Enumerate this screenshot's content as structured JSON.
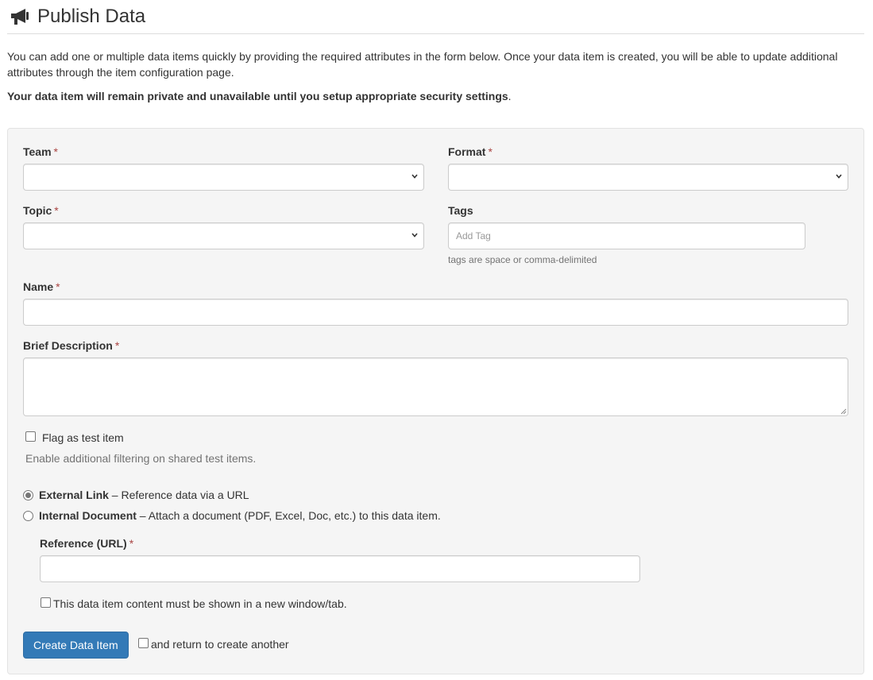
{
  "page": {
    "title": "Publish Data",
    "title_icon": "megaphone-icon",
    "intro": "You can add one or multiple data items quickly by providing the required attributes in the form below. Once your data item is created, you will be able to update additional attributes through the item configuration page.",
    "warning_bold": "Your data item will remain private and unavailable until you setup appropriate security settings",
    "warning_end": "."
  },
  "form": {
    "required_marker": "*",
    "team": {
      "label": "Team",
      "value": ""
    },
    "format": {
      "label": "Format",
      "value": ""
    },
    "topic": {
      "label": "Topic",
      "value": ""
    },
    "tags": {
      "label": "Tags",
      "placeholder": "Add Tag",
      "help": "tags are space or comma-delimited"
    },
    "name": {
      "label": "Name",
      "value": ""
    },
    "description": {
      "label": "Brief Description",
      "value": ""
    },
    "test_flag": {
      "label": "Flag as test item",
      "help": "Enable additional filtering on shared test items.",
      "checked": false
    },
    "link_type": {
      "selected": "external",
      "external": {
        "title": "External Link",
        "desc": " – Reference data via a URL"
      },
      "internal": {
        "title": "Internal Document",
        "desc": " – Attach a document (PDF, Excel, Doc, etc.) to this data item."
      }
    },
    "reference_url": {
      "label": "Reference (URL)",
      "value": ""
    },
    "new_window": {
      "label": "This data item content must be shown in a new window/tab.",
      "checked": false
    },
    "submit_label": "Create Data Item",
    "return_another": {
      "label": "and return to create another",
      "checked": false
    }
  },
  "colors": {
    "primary": "#337ab7",
    "required": "#a94442",
    "panel_bg": "#f5f5f5"
  }
}
